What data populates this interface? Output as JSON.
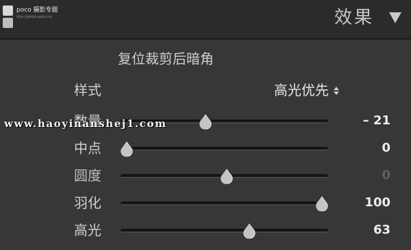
{
  "header": {
    "logo": {
      "brand": "poco 摄影专题",
      "url": "http://photo.poco.cn/"
    },
    "title": "效果",
    "collapse_icon": "triangle-down-icon"
  },
  "vignette": {
    "reset_label": "复位裁剪后暗角",
    "style": {
      "label": "样式",
      "value": "高光优先",
      "icon": "up-down-arrows-icon"
    },
    "sliders": [
      {
        "id": "amount",
        "label": "数量",
        "value": "– 21",
        "position": 0.41,
        "enabled": true
      },
      {
        "id": "midpoint",
        "label": "中点",
        "value": "0",
        "position": 0.03,
        "enabled": true
      },
      {
        "id": "roundness",
        "label": "圆度",
        "value": "0",
        "position": 0.51,
        "enabled": false
      },
      {
        "id": "feather",
        "label": "羽化",
        "value": "100",
        "position": 0.97,
        "enabled": true
      },
      {
        "id": "highlights",
        "label": "高光",
        "value": "63",
        "position": 0.62,
        "enabled": true
      }
    ]
  },
  "watermark": {
    "text": "www.haoyinanshej1.com"
  },
  "colors": {
    "panel": "#373737",
    "header": "#2b2b2b",
    "text": "#cfcfcf",
    "value": "#ececec",
    "disabled_value": "#5f5f5f"
  }
}
